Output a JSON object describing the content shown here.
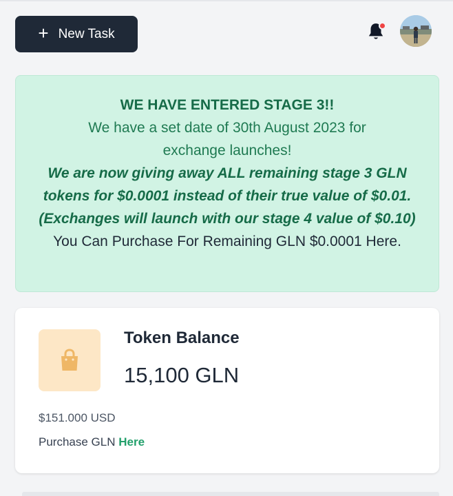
{
  "header": {
    "new_task_label": "New Task",
    "plus_icon": "plus-icon",
    "notification_icon": "bell-icon",
    "notification_dot_color": "#ef4444",
    "avatar": "user-avatar"
  },
  "announcement": {
    "heading": "WE HAVE ENTERED STAGE 3!!",
    "subtext": "We have a set date of 30th August 2023 for exchange launches!",
    "highlight": "We are now giving away ALL remaining stage 3 GLN tokens for $0.0001 instead of their true value of $0.01. (Exchanges will launch with our stage 4 value of $0.10)",
    "purchase_text": "You Can Purchase For Remaining GLN $0.0001 Here.",
    "background_color": "#d1f3e4"
  },
  "balance": {
    "icon": "shopping-bag-icon",
    "title": "Token Balance",
    "amount": "15,100 GLN",
    "usd_value": "$151.000 USD",
    "purchase_prefix": "Purchase GLN",
    "purchase_link": "Here",
    "link_color": "#22a06b"
  }
}
